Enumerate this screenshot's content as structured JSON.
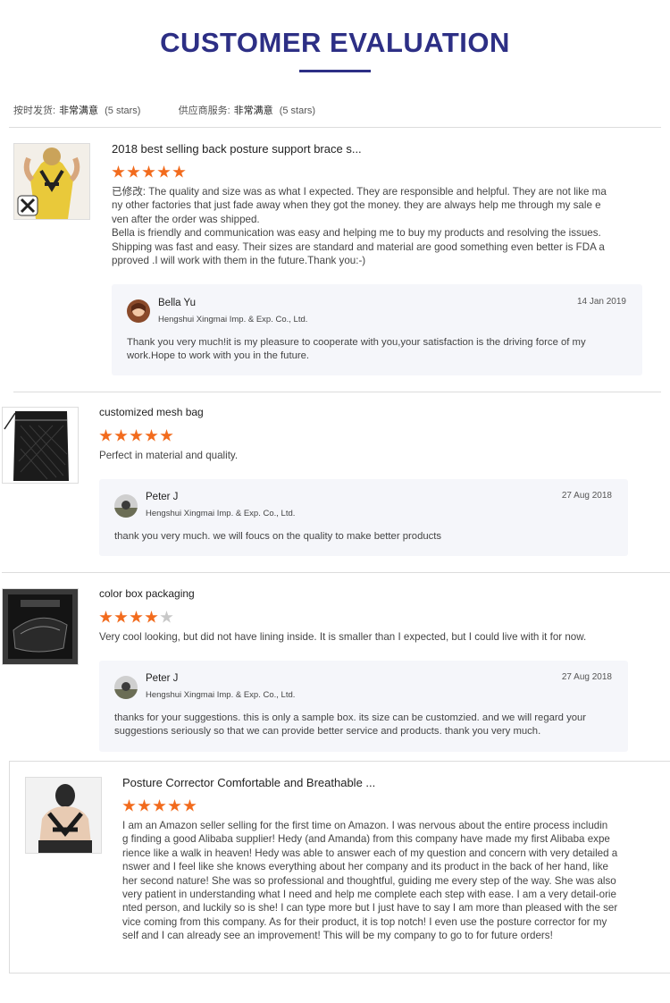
{
  "header": {
    "title": "CUSTOMER EVALUATION"
  },
  "ratings": {
    "delivery_label": "按时发货:",
    "delivery_value": "非常满意",
    "delivery_stars": "(5 stars)",
    "service_label": "供应商服务:",
    "service_value": "非常满意",
    "service_stars": "(5 stars)"
  },
  "reviews": [
    {
      "product": "2018 best selling back posture support brace s...",
      "stars": 5,
      "text_lines": [
        "已修改: The quality and size was as what I expected. They are responsible and helpful. They are not like ma",
        "ny other factories that just fade away when they got the money. they are always help me through my sale e",
        "ven after the order was shipped.",
        "Bella is friendly and communication was easy and helping me to buy my products and resolving the issues.",
        "Shipping was fast and easy. Their sizes are standard and material are good something even better is FDA a",
        "pproved .I will work with them in the future.Thank you:-)"
      ],
      "reply": {
        "name": "Bella Yu",
        "company": "Hengshui Xingmai Imp. & Exp. Co., Ltd.",
        "date": "14 Jan 2019",
        "lines": [
          "Thank you very much!it is my pleasure to cooperate with you,your satisfaction is the driving force of my",
          "work.Hope to work with you in the future."
        ]
      }
    },
    {
      "product": "customized mesh bag",
      "stars": 5,
      "text_lines": [
        "Perfect in material and quality."
      ],
      "reply": {
        "name": "Peter J",
        "company": "Hengshui Xingmai Imp. & Exp. Co., Ltd.",
        "date": "27 Aug 2018",
        "lines": [
          "thank you very much. we will foucs on the quality to make better products"
        ]
      }
    },
    {
      "product": "color box packaging",
      "stars": 4,
      "text_lines": [
        "Very cool looking, but did not have lining inside. It is smaller than I expected, but I could live with it for now."
      ],
      "reply": {
        "name": "Peter J",
        "company": "Hengshui Xingmai Imp. & Exp. Co., Ltd.",
        "date": "27 Aug 2018",
        "lines": [
          "thanks for your suggestions. this is only a sample box. its size can be customzied. and we will regard your",
          "suggestions seriously so that we can provide better service and products. thank you very much."
        ]
      }
    },
    {
      "product": "Posture Corrector Comfortable and Breathable ...",
      "stars": 5,
      "text_lines": [
        "I am an Amazon seller selling for the first time on Amazon. I was nervous about the entire process includin",
        "g finding a good Alibaba supplier! Hedy (and Amanda) from this company have made my first Alibaba expe",
        "rience like a walk in heaven! Hedy was able to answer each of my question and concern with very detailed a",
        "nswer and I feel like she knows everything about her company and its product in the back of her hand, like",
        "her second nature! She was so professional and thoughtful, guiding me every step of the way. She was also",
        "very patient in understanding what I need and help me complete each step with ease. I am a very detail-orie",
        "nted person, and luckily so is she! I can type more but I just have to say I am more than pleased with the ser",
        "vice coming from this company. As for their product, it is top notch! I even use the posture corrector for my",
        "self and I can already see an improvement! This will be my company to go to for future orders!"
      ]
    }
  ],
  "colors": {
    "title": "#2d2f85",
    "star": "#f26b1d",
    "star_off": "#c8c8c8",
    "reply_bg": "#f5f6fa"
  }
}
